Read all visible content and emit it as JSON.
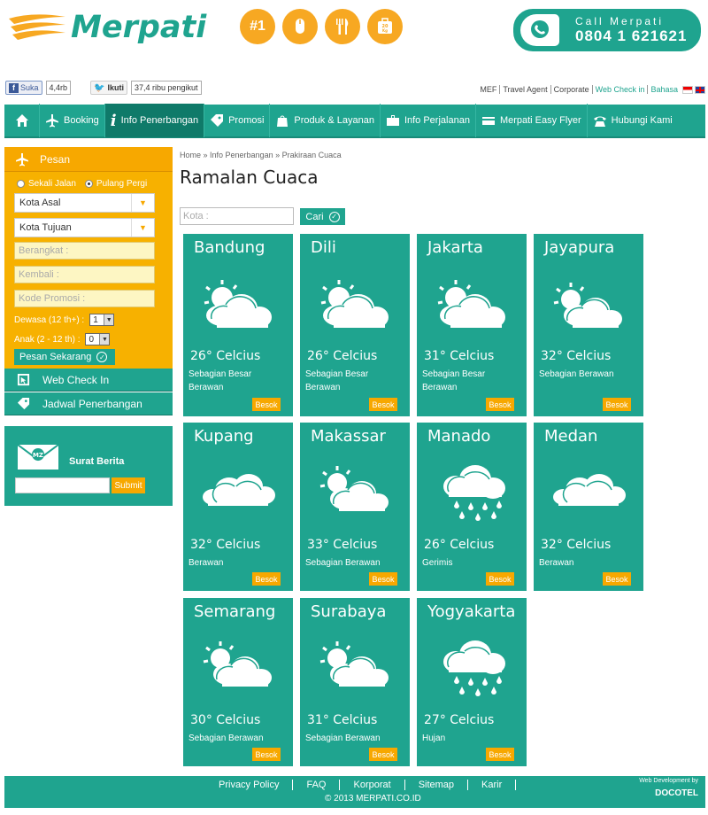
{
  "header": {
    "logo_text": "Merpati",
    "badges": [
      "#1"
    ],
    "callbox_label": "Call Merpati",
    "callbox_number": "0804 1 621621"
  },
  "social": {
    "fb_label": "Suka",
    "fb_count": "4,4rb",
    "tw_label": "Ikuti",
    "tw_count": "37,4 ribu pengikut"
  },
  "toplinks": [
    "MEF",
    "Travel Agent",
    "Corporate",
    "Web Check in",
    "Bahasa"
  ],
  "nav": [
    "Booking",
    "Info Penerbangan",
    "Promosi",
    "Produk & Layanan",
    "Info Perjalanan",
    "Merpati Easy Flyer",
    "Hubungi Kami"
  ],
  "booking": {
    "title": "Pesan",
    "trip_one_way": "Sekali Jalan",
    "trip_round": "Pulang Pergi",
    "origin": "Kota Asal",
    "destination": "Kota Tujuan",
    "depart_placeholder": "Berangkat :",
    "return_placeholder": "Kembali :",
    "promo_placeholder": "Kode Promosi :",
    "adult_label": "Dewasa (12 th+)  :",
    "adult_value": "1",
    "child_label": "Anak (2 - 12 th)   :",
    "child_value": "0",
    "submit": "Pesan Sekarang"
  },
  "sidebar_links": [
    "Web Check In",
    "Jadwal Penerbangan"
  ],
  "newsletter": {
    "title": "Surat Berita",
    "submit": "Submit"
  },
  "breadcrumb": "Home  »  Info Penerbangan  »  Prakiraan Cuaca",
  "page_title": "Ramalan Cuaca",
  "search": {
    "placeholder": "Kota :",
    "button": "Cari"
  },
  "besok_label": "Besok",
  "cities": [
    {
      "name": "Bandung",
      "temp": "26° Celcius",
      "desc": "Sebagian Besar Berawan",
      "icon": "sun-cloud-large"
    },
    {
      "name": "Dili",
      "temp": "26° Celcius",
      "desc": "Sebagian Besar Berawan",
      "icon": "sun-cloud-large"
    },
    {
      "name": "Jakarta",
      "temp": "31° Celcius",
      "desc": "Sebagian Besar Berawan",
      "icon": "sun-cloud-large"
    },
    {
      "name": "Jayapura",
      "temp": "32° Celcius",
      "desc": "Sebagian Berawan",
      "icon": "sun-cloud"
    },
    {
      "name": "Kupang",
      "temp": "32° Celcius",
      "desc": "Berawan",
      "icon": "cloudy"
    },
    {
      "name": "Makassar",
      "temp": "33° Celcius",
      "desc": "Sebagian Berawan",
      "icon": "sun-cloud"
    },
    {
      "name": "Manado",
      "temp": "26° Celcius",
      "desc": "Gerimis",
      "icon": "rain"
    },
    {
      "name": "Medan",
      "temp": "32° Celcius",
      "desc": "Berawan",
      "icon": "cloudy"
    },
    {
      "name": "Semarang",
      "temp": "30° Celcius",
      "desc": "Sebagian Berawan",
      "icon": "sun-cloud"
    },
    {
      "name": "Surabaya",
      "temp": "31° Celcius",
      "desc": "Sebagian Berawan",
      "icon": "sun-cloud"
    },
    {
      "name": "Yogyakarta",
      "temp": "27° Celcius",
      "desc": "Hujan",
      "icon": "rain"
    }
  ],
  "footer": {
    "links": [
      "Privacy Policy",
      "FAQ",
      "Korporat",
      "Sitemap",
      "Karir"
    ],
    "copyright": "© 2013 MERPATI.CO.ID",
    "credit_label": "Web Development by",
    "credit_name": "DOCOTEL"
  },
  "colors": {
    "teal": "#1fa48f",
    "orange": "#f7a800"
  }
}
